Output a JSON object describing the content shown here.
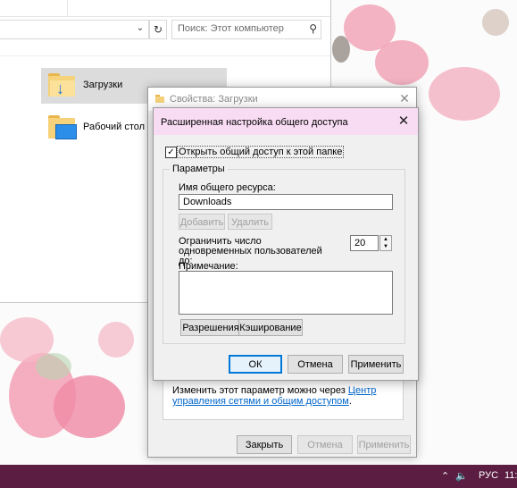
{
  "explorer": {
    "search_placeholder": "Поиск: Этот компьютер",
    "items": [
      {
        "label": "Загрузки"
      },
      {
        "label": "Рабочий стол"
      }
    ]
  },
  "properties_dialog": {
    "title": "Свойства: Загрузки",
    "info_text": "Изменить этот параметр можно через ",
    "info_link": "Центр управления сетями и общим доступом",
    "info_tail": ".",
    "buttons": {
      "close": "Закрыть",
      "cancel": "Отмена",
      "apply": "Применить"
    }
  },
  "advanced_sharing": {
    "title": "Расширенная настройка общего доступа",
    "share_checkbox_label": "Открыть общий доступ к этой папке",
    "share_checked": true,
    "group_label": "Параметры",
    "share_name_label": "Имя общего ресурса:",
    "share_name_value": "Downloads",
    "add_button": "Добавить",
    "remove_button": "Удалить",
    "limit_label": "Ограничить число одновременных пользователей до:",
    "limit_value": "20",
    "comment_label": "Примечание:",
    "comment_value": "",
    "permissions_button": "Разрешения",
    "caching_button": "Кэширование",
    "ok_button": "ОК",
    "cancel_button": "Отмена",
    "apply_button": "Применить"
  },
  "taskbar": {
    "language": "РУС",
    "clock": "11:"
  },
  "colors": {
    "taskbar": "#5b1e42",
    "dialog_title_bg": "#f8dcf3",
    "link": "#0066cc",
    "accent": "#0078d7"
  }
}
